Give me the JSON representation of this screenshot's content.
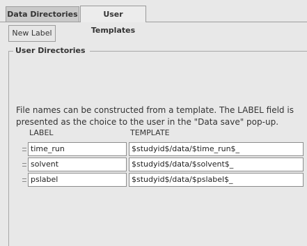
{
  "tabs": [
    {
      "label": "Data Directories",
      "active": false
    },
    {
      "label": "User Templates",
      "active": true
    }
  ],
  "toolbar": {
    "new_label_button": "New Label"
  },
  "group": {
    "title": "User Directories"
  },
  "description": {
    "line1": "File names can be constructed from a template. The LABEL field is",
    "line2": "presented as the choice to the user in the \"Data save\" pop-up."
  },
  "columns": {
    "label": "LABEL",
    "template": "TEMPLATE"
  },
  "rows": [
    {
      "label": "time_run",
      "template": "$studyid$/data/$time_run$_"
    },
    {
      "label": "solvent",
      "template": "$studyid$/data/$solvent$_"
    },
    {
      "label": "pslabel",
      "template": "$studyid$/data/$pslabel$_"
    }
  ]
}
